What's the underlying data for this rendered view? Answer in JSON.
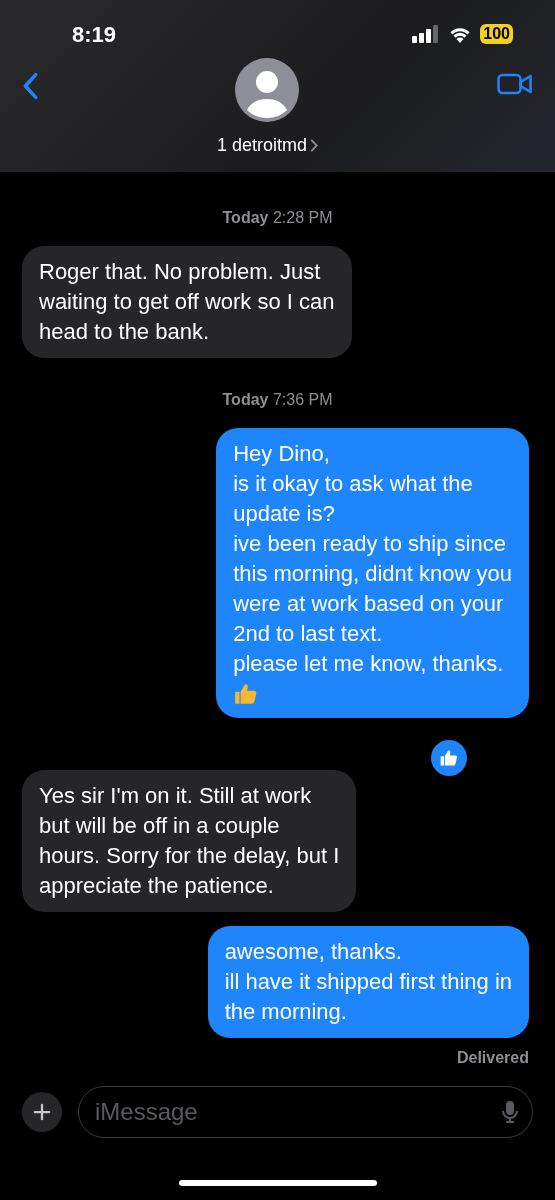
{
  "status_bar": {
    "time": "8:19",
    "battery": "100"
  },
  "header": {
    "contact_name": "1 detroitmd"
  },
  "messages": [
    {
      "kind": "timestamp",
      "text": "**Today** 2:28 PM"
    },
    {
      "kind": "received",
      "lines": [
        "Roger that. No problem. Just",
        "waiting to get off work so I can",
        "head to the bank."
      ]
    },
    {
      "kind": "timestamp",
      "text": "**Today** 7:36 PM"
    },
    {
      "kind": "sent",
      "lines": [
        "Hey Dino,",
        "is it okay to ask what the",
        "update is?",
        "ive been ready to ship since",
        "this morning, didnt know you",
        "were at work based on your",
        "2nd to last text.",
        "please let me know, thanks."
      ],
      "thumbs_up_emoji": true
    },
    {
      "kind": "received",
      "liked": true,
      "lines": [
        "Yes sir I'm on it. Still at work",
        "but will be off in a couple",
        "hours. Sorry for the delay, but I",
        "appreciate the patience."
      ]
    },
    {
      "kind": "sent",
      "lines": [
        "awesome, thanks.",
        "ill have it shipped first thing in",
        "the morning."
      ]
    },
    {
      "kind": "status",
      "text": "Delivered"
    }
  ],
  "composer": {
    "placeholder": "iMessage"
  }
}
